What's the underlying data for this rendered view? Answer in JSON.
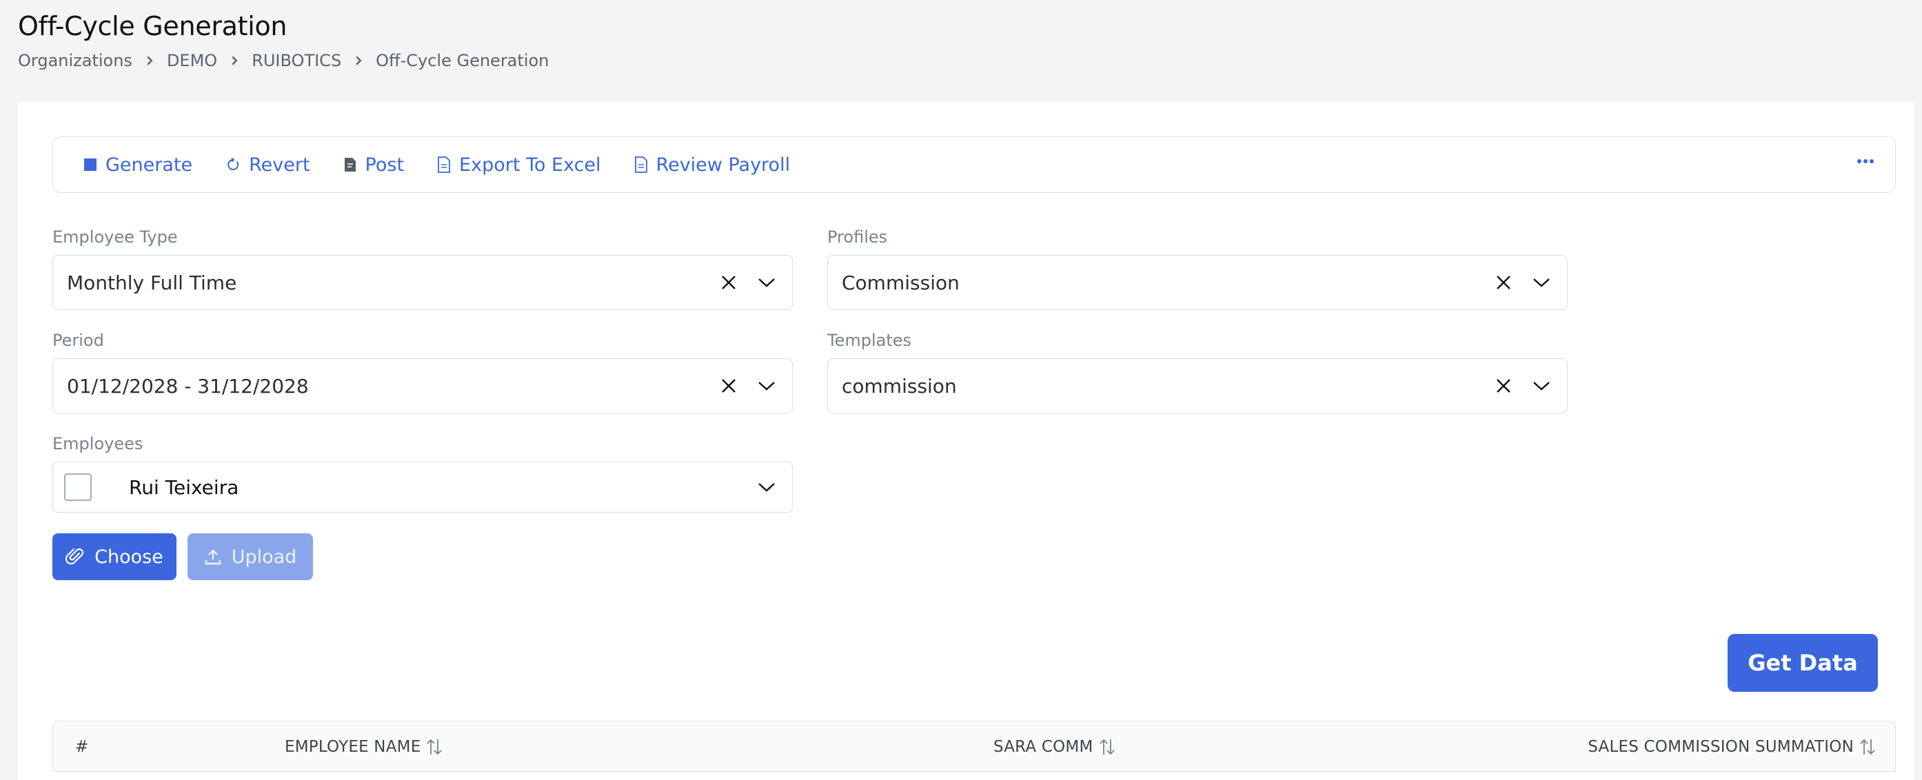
{
  "page": {
    "title": "Off-Cycle Generation",
    "breadcrumb": [
      "Organizations",
      "DEMO",
      "RUIBOTICS",
      "Off-Cycle Generation"
    ]
  },
  "toolbar": {
    "generate": "Generate",
    "revert": "Revert",
    "post": "Post",
    "export": "Export To Excel",
    "review": "Review Payroll"
  },
  "form": {
    "employee_type": {
      "label": "Employee Type",
      "value": "Monthly Full Time"
    },
    "profiles": {
      "label": "Profiles",
      "value": "Commission"
    },
    "period": {
      "label": "Period",
      "value": "01/12/2028 - 31/12/2028"
    },
    "templates": {
      "label": "Templates",
      "value": "commission"
    },
    "employees": {
      "label": "Employees",
      "value": "Rui Teixeira"
    }
  },
  "buttons": {
    "choose": "Choose",
    "upload": "Upload",
    "get_data": "Get Data"
  },
  "table": {
    "columns": [
      "#",
      "EMPLOYEE NAME",
      "SARA COMM",
      "SALES COMMISSION SUMMATION"
    ]
  },
  "colors": {
    "accent": "#3b66dd",
    "accent_disabled": "#8aa6ea",
    "background": "#f4f4f4"
  }
}
